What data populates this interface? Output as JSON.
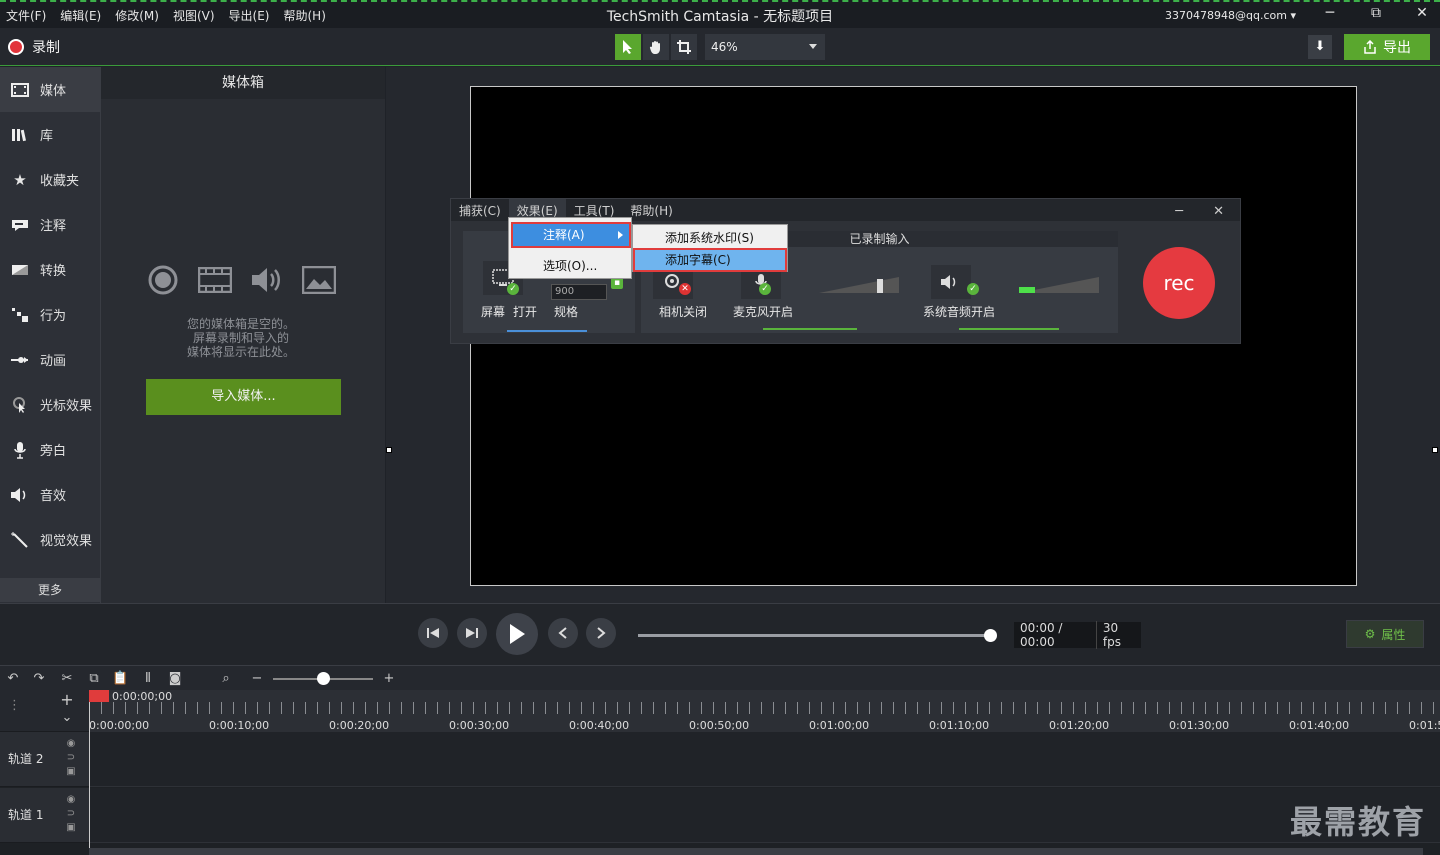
{
  "menubar": {
    "items": [
      "文件(F)",
      "编辑(E)",
      "修改(M)",
      "视图(V)",
      "导出(E)",
      "帮助(H)"
    ]
  },
  "window": {
    "title": "TechSmith Camtasia - 无标题项目",
    "account": "3370478948@qq.com ▾",
    "minimize": "─",
    "maximize": "⧉",
    "close": "✕"
  },
  "toolbar": {
    "record_label": "录制",
    "zoom_value": "46%",
    "export_label": "导出"
  },
  "sidebar": {
    "items": [
      {
        "label": "媒体",
        "icon": "film-icon"
      },
      {
        "label": "库",
        "icon": "library-icon"
      },
      {
        "label": "收藏夹",
        "icon": "star-icon"
      },
      {
        "label": "注释",
        "icon": "annotation-icon"
      },
      {
        "label": "转换",
        "icon": "transition-icon"
      },
      {
        "label": "行为",
        "icon": "behavior-icon"
      },
      {
        "label": "动画",
        "icon": "animation-icon"
      },
      {
        "label": "光标效果",
        "icon": "cursor-icon"
      },
      {
        "label": "旁白",
        "icon": "microphone-icon"
      },
      {
        "label": "音效",
        "icon": "speaker-icon"
      },
      {
        "label": "视觉效果",
        "icon": "wand-icon"
      }
    ],
    "more_label": "更多",
    "add_label": "+"
  },
  "mediabin": {
    "title": "媒体箱",
    "empty_line1": "您的媒体箱是空的。",
    "empty_line2": "屏幕录制和导入的",
    "empty_line3": "媒体将显示在此处。",
    "import_label": "导入媒体..."
  },
  "recorder": {
    "menu": [
      "捕获(C)",
      "效果(E)",
      "工具(T)",
      "帮助(H)"
    ],
    "minimize": "─",
    "close": "✕",
    "right_panel_title": "已录制输入",
    "screen_label": "屏幕",
    "screen_state": "打开",
    "spec_label": "规格",
    "width_value": "900",
    "camera_label": "相机关闭",
    "mic_label": "麦克风开启",
    "system_audio_label": "系统音频开启",
    "rec_label": "rec"
  },
  "effects_menu": {
    "item_annotation": "注释(A)",
    "item_options": "选项(O)..."
  },
  "annotation_submenu": {
    "item_watermark": "添加系统水印(S)",
    "item_caption": "添加字幕(C)"
  },
  "playback": {
    "timecode": "00:00 / 00:00",
    "fps": "30 fps",
    "props_label": "属性"
  },
  "timeline": {
    "playhead_time": "0:00:00;00",
    "ruler_labels": [
      "0:00:00;00",
      "0:00:10;00",
      "0:00:20;00",
      "0:00:30;00",
      "0:00:40;00",
      "0:00:50;00",
      "0:01:00;00",
      "0:01:10;00",
      "0:01:20;00",
      "0:01:30;00",
      "0:01:40;00",
      "0:01:5"
    ],
    "tracks": [
      "轨道 2",
      "轨道 1"
    ],
    "add_label": "+",
    "collapse_label": "⌄"
  },
  "watermark": "最需教育",
  "colors": {
    "accent_green": "#5aa72e",
    "record_red": "#e53a40",
    "highlight_outline": "#e03c3c"
  }
}
